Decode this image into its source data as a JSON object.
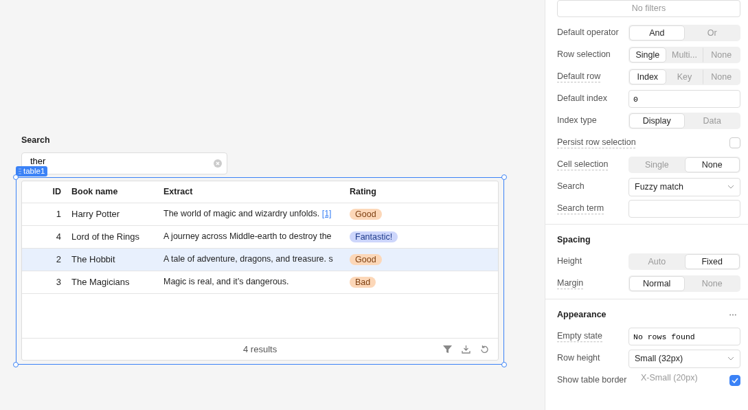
{
  "canvas": {
    "search_widget": {
      "label": "Search",
      "value": "ther"
    },
    "table": {
      "tag": "table1",
      "columns": [
        "ID",
        "Book name",
        "Extract",
        "Rating"
      ],
      "rows": [
        {
          "id": "1",
          "book_name": "Harry Potter",
          "extract": "The world of magic and wizardry unfolds.",
          "extract_link": "[1]",
          "rating": "Good",
          "color": "#fcd7b8",
          "selected": false
        },
        {
          "id": "4",
          "book_name": "Lord of the Rings",
          "extract": "A journey across Middle-earth to destroy the",
          "rating": "Fantastic!",
          "color": "#cdd6fb",
          "selected": false
        },
        {
          "id": "2",
          "book_name": "The Hobbit",
          "extract": "A tale of adventure, dragons, and treasure. s",
          "rating": "Good",
          "color": "#fcd7b8",
          "selected": true
        },
        {
          "id": "3",
          "book_name": "The Magicians",
          "extract": "Magic is real, and it’s dangerous.",
          "rating": "Bad",
          "color": "#fcd7b8",
          "selected": false
        }
      ],
      "footer": "4 results"
    }
  },
  "inspector": {
    "sections": [
      {
        "filters_button": "No filters",
        "rows": [
          {
            "kind": "segmented",
            "label": "Default operator",
            "hint": false,
            "options": [
              {
                "label": "And",
                "selected": true
              },
              {
                "label": "Or",
                "selected": false
              }
            ]
          },
          {
            "kind": "segmented",
            "label": "Row selection",
            "hint": false,
            "options": [
              {
                "label": "Single",
                "selected": true
              },
              {
                "label": "Multi...",
                "selected": false
              },
              {
                "label": "None",
                "selected": false
              }
            ]
          },
          {
            "kind": "segmented",
            "label": "Default row",
            "hint": true,
            "options": [
              {
                "label": "Index",
                "selected": true
              },
              {
                "label": "Key",
                "selected": false
              },
              {
                "label": "None",
                "selected": false
              }
            ]
          },
          {
            "kind": "code_input",
            "label": "Default index",
            "hint": false,
            "value": "0"
          },
          {
            "kind": "segmented",
            "label": "Index type",
            "hint": false,
            "options": [
              {
                "label": "Display",
                "selected": true
              },
              {
                "label": "Data",
                "selected": false
              }
            ]
          },
          {
            "kind": "checkbox",
            "label": "Persist row selection",
            "hint": true,
            "checked": false
          },
          {
            "kind": "segmented",
            "label": "Cell selection",
            "hint": true,
            "options": [
              {
                "label": "Single",
                "selected": false
              },
              {
                "label": "None",
                "selected": true
              }
            ]
          },
          {
            "kind": "select",
            "label": "Search",
            "hint": false,
            "value": "Fuzzy match"
          },
          {
            "kind": "code_input",
            "label": "Search term",
            "hint": true
          }
        ]
      },
      {
        "title": "Spacing",
        "menu": false,
        "rows": [
          {
            "kind": "segmented",
            "label": "Height",
            "hint": false,
            "options": [
              {
                "label": "Auto",
                "selected": false
              },
              {
                "label": "Fixed",
                "selected": true
              }
            ]
          },
          {
            "kind": "segmented",
            "label": "Margin",
            "hint": true,
            "options": [
              {
                "label": "Normal",
                "selected": true
              },
              {
                "label": "None",
                "selected": false
              }
            ]
          }
        ]
      },
      {
        "title": "Appearance",
        "menu": true,
        "rows": [
          {
            "kind": "code_input",
            "label": "Empty state",
            "hint": true,
            "value": "No rows found"
          },
          {
            "kind": "select",
            "label": "Row height",
            "hint": false,
            "value": "Small (32px)",
            "dropdown_option": "X-Small (20px)"
          },
          {
            "kind": "checkbox",
            "label": "Show table border",
            "hint": false,
            "checked": true
          }
        ]
      }
    ]
  }
}
